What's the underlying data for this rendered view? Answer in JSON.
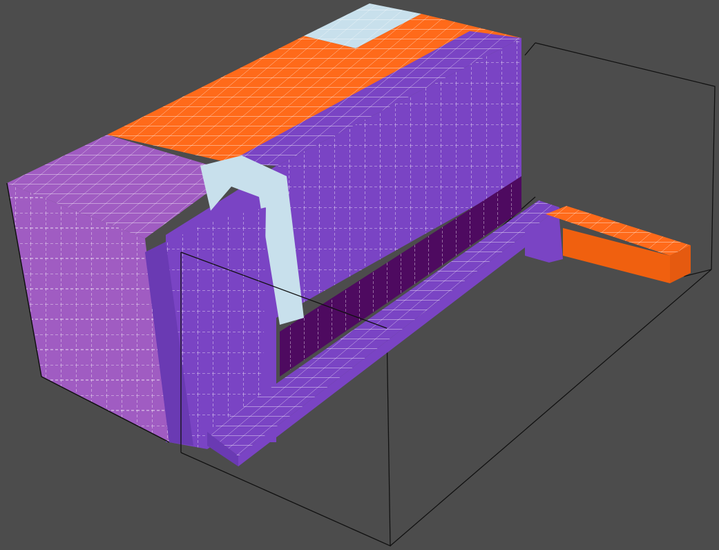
{
  "viewport": {
    "background_color": "#4c4c4c",
    "edge_color": "#111111",
    "grid_line_color": "#ffffff"
  },
  "materials": {
    "lavender_block": {
      "front": "#a05cc2",
      "top": "#a05cc2"
    },
    "purple_block": {
      "front": "#7a44c4",
      "top": "#7a44c4",
      "side": "#6a3ab3"
    },
    "dark_recess": {
      "front": "#4e0a60"
    },
    "orange_strip": {
      "top": "#ff6a1a",
      "front": "#f0600f"
    },
    "light_blue_channel": {
      "fill": "#c8e0ec"
    }
  }
}
